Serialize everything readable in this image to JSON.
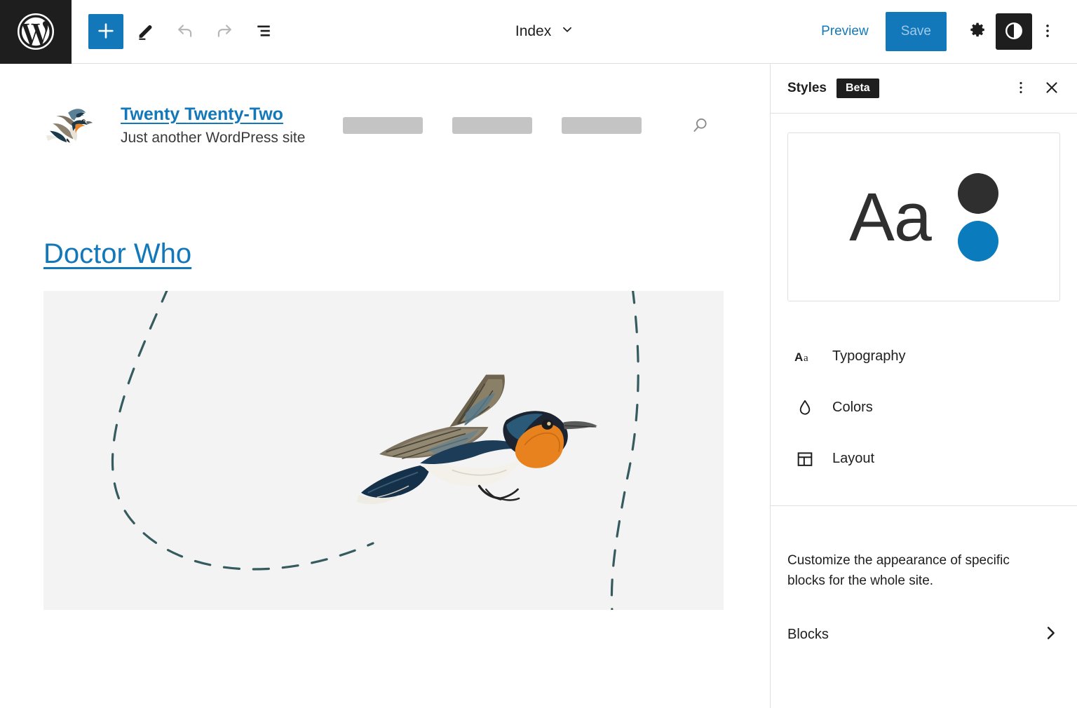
{
  "app": {
    "name": "WordPress Site Editor",
    "accent_blue": "#1378b9",
    "dark": "#1e1e1e",
    "placeholder_gray": "#c4c4c4",
    "canvas_gray": "#f3f3f3",
    "dashed_line_color": "#355b5f"
  },
  "toolbar": {
    "wp_logo_icon": "wordpress-logo-icon",
    "add_block_icon": "plus-icon",
    "add_block_label": "Toggle block inserter",
    "edit_icon": "pencil-icon",
    "edit_label": "Edit",
    "undo_icon": "undo-arrow-icon",
    "undo_label": "Undo",
    "redo_icon": "redo-arrow-icon",
    "redo_label": "Redo",
    "list_view_icon": "list-view-icon",
    "list_view_label": "List View",
    "document_title": "Index",
    "document_chevron_icon": "chevron-down-icon",
    "preview_label": "Preview",
    "save_label": "Save",
    "settings_icon": "gear-icon",
    "settings_label": "Settings",
    "styles_icon": "contrast-half-circle-icon",
    "styles_label": "Styles",
    "more_icon": "ellipsis-vertical-icon",
    "more_label": "Options"
  },
  "canvas": {
    "site_logo_icon": "flying-bird-logo",
    "site_title": "Twenty Twenty-Two",
    "site_tagline": "Just another WordPress site",
    "nav_placeholders": [
      "",
      "",
      ""
    ],
    "search_icon": "search-icon",
    "post_title": "Doctor Who",
    "featured_image_alt": "Illustration of a flying swallow with dashed flight-path curves"
  },
  "sidebar": {
    "title": "Styles",
    "badge": "Beta",
    "more_icon": "ellipsis-vertical-icon",
    "more_label": "More Styles actions",
    "close_icon": "close-x-icon",
    "close_label": "Close Styles sidebar",
    "preview_card": {
      "sample_text": "Aa",
      "dot_top_color": "#2f2f2f",
      "dot_bottom_color": "#0a7bbd"
    },
    "menu": [
      {
        "label": "Typography",
        "icon": "typography-aa-icon"
      },
      {
        "label": "Colors",
        "icon": "color-droplet-icon"
      },
      {
        "label": "Layout",
        "icon": "layout-grid-icon"
      }
    ],
    "blocks_description": "Customize the appearance of specific blocks for the whole site.",
    "blocks_label": "Blocks",
    "blocks_chevron_icon": "chevron-right-icon"
  }
}
